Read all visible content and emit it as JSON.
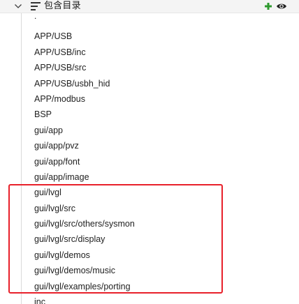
{
  "header": {
    "title": "包含目录",
    "icons": {
      "collapse": "chevron-down-icon",
      "list": "list-icon",
      "add": "plus-icon",
      "visibility": "eye-icon"
    },
    "add_color": "#2e9a2e"
  },
  "directories": [
    ".",
    "APP/USB",
    "APP/USB/inc",
    "APP/USB/src",
    "APP/USB/usbh_hid",
    "APP/modbus",
    "BSP",
    "gui/app",
    "gui/app/pvz",
    "gui/app/font",
    "gui/app/image",
    "gui/lvgl",
    "gui/lvgl/src",
    "gui/lvgl/src/others/sysmon",
    "gui/lvgl/src/display",
    "gui/lvgl/demos",
    "gui/lvgl/demos/music",
    "gui/lvgl/examples/porting",
    "inc"
  ],
  "annotation": {
    "color": "#e8202a"
  }
}
